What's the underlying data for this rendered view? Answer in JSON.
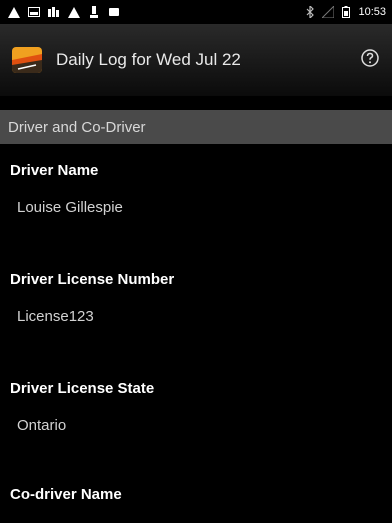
{
  "status_bar": {
    "time": "10:53",
    "left_icons": [
      "alert-triangle-icon",
      "image-icon",
      "signal-icon",
      "alert-triangle-icon",
      "download-icon",
      "square-icon"
    ],
    "right_icons": [
      "bluetooth-icon",
      "cell-signal-icon",
      "battery-icon"
    ]
  },
  "app_bar": {
    "title": "Daily Log for Wed Jul 22",
    "logo_icon": "road-logo-icon",
    "help_icon": "help-icon"
  },
  "section": {
    "title": "Driver and Co-Driver"
  },
  "fields": [
    {
      "label": "Driver Name",
      "value": "Louise Gillespie"
    },
    {
      "label": "Driver License Number",
      "value": "License123"
    },
    {
      "label": "Driver License State",
      "value": "Ontario"
    },
    {
      "label": "Co-driver Name",
      "value": ""
    }
  ],
  "colors": {
    "background": "#000000",
    "section_header": "#4a4a4a",
    "label": "#ffffff",
    "value": "#d2d2d2"
  }
}
